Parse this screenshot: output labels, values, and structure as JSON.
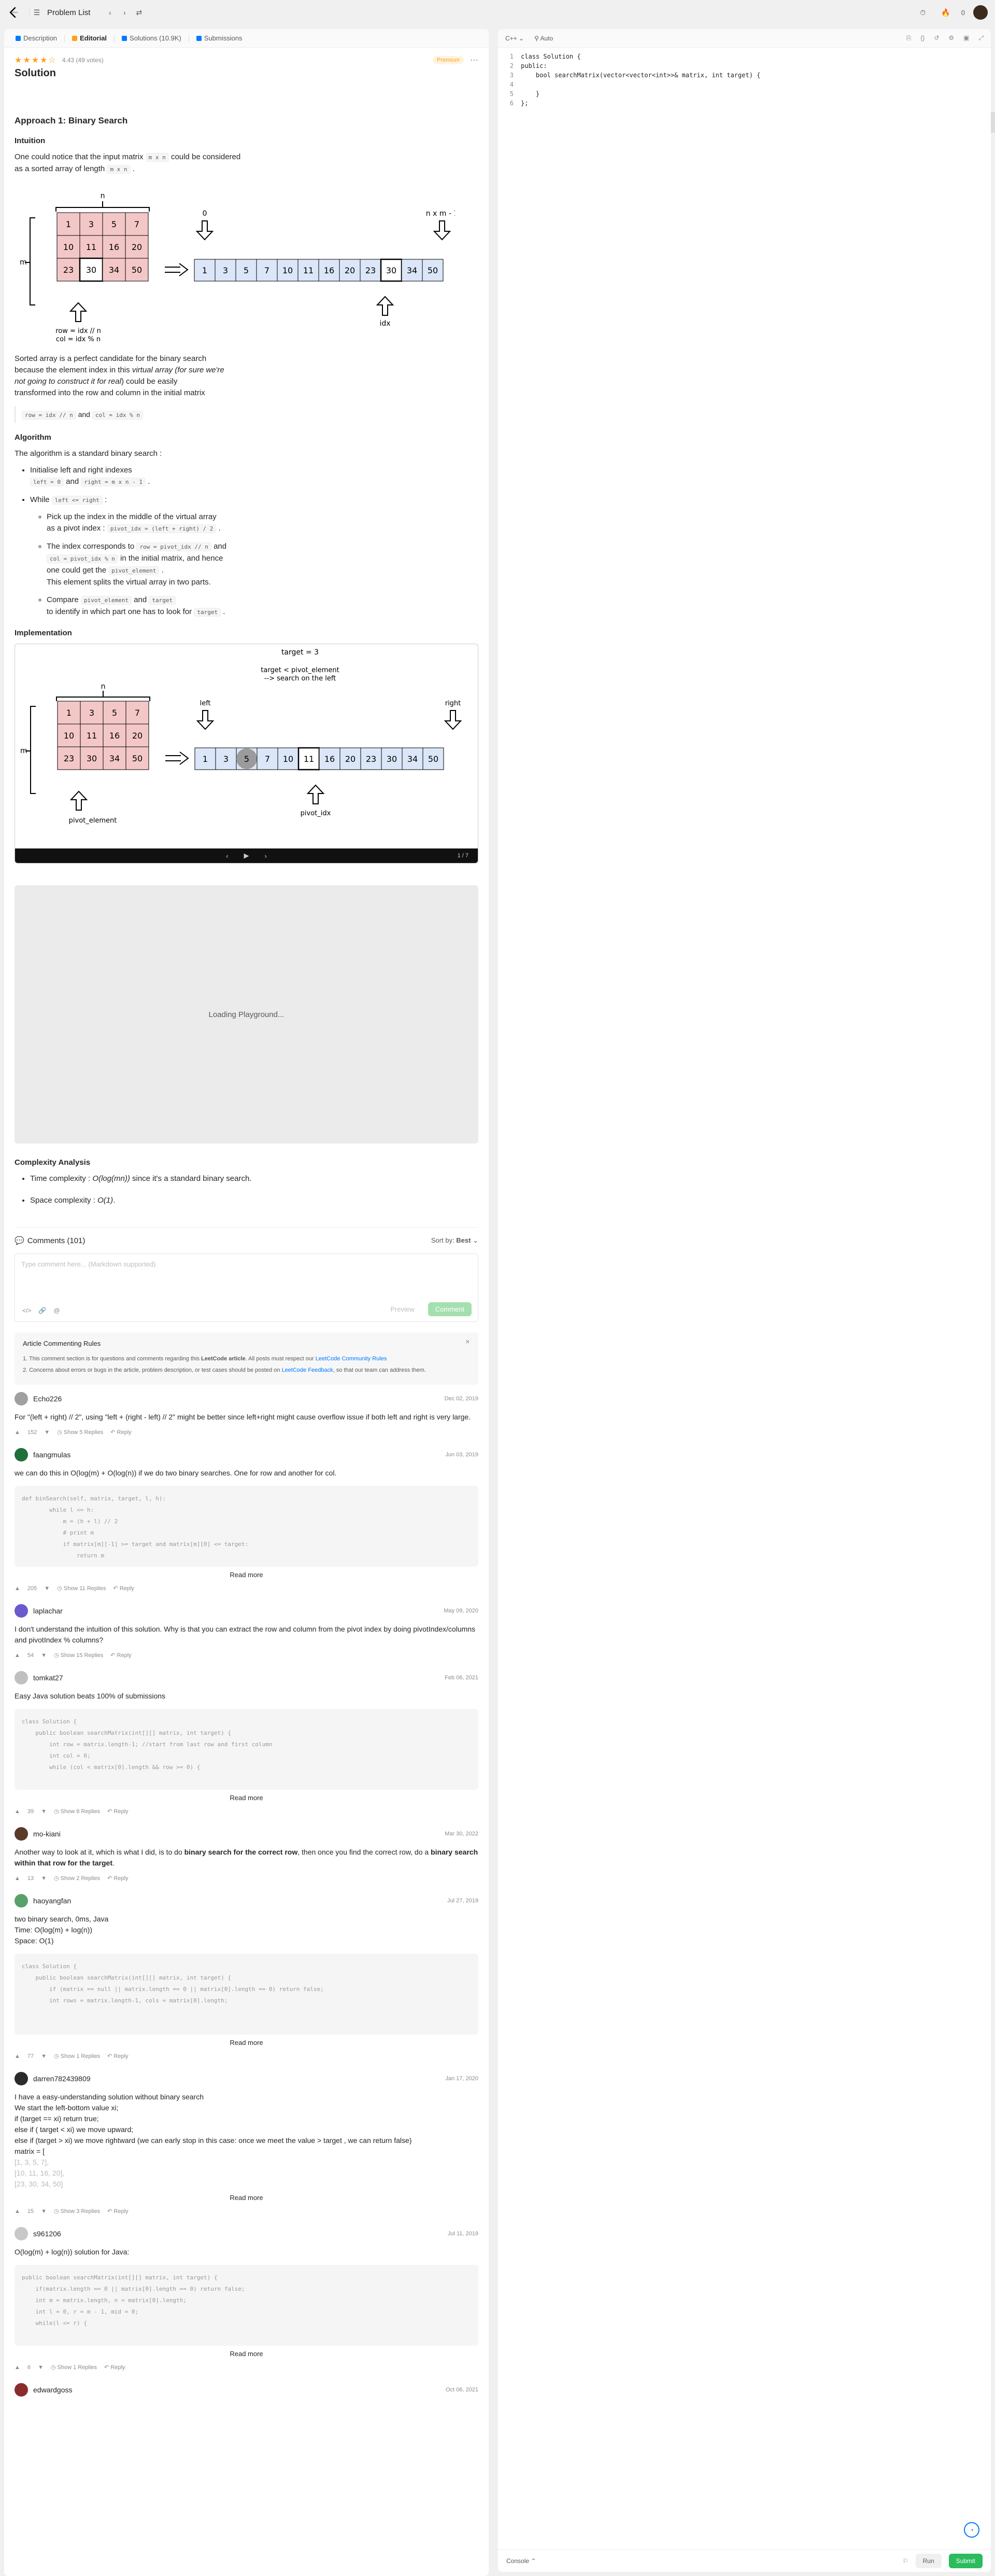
{
  "topbar": {
    "title": "Problem List",
    "premium_count": "0"
  },
  "tabs": [
    {
      "label": "Description"
    },
    {
      "label": "Editorial"
    },
    {
      "label": "Solutions (10.9K)"
    },
    {
      "label": "Submissions"
    }
  ],
  "article": {
    "rating_text": "4.43 (49 votes)",
    "premium_label": "Premium",
    "title": "Solution",
    "approach_title": "Approach 1: Binary Search",
    "intuition_title": "Intuition",
    "intuition_p1": "One could notice that the input matrix",
    "intuition_code1": "m x n",
    "intuition_p1b": "could be considered",
    "intuition_p2": "as a sorted array of length",
    "intuition_code2": "m x n",
    "sorted_p1": "Sorted array is a perfect candidate for the binary search",
    "sorted_p2a": "because the element index in this",
    "sorted_p2b": "virtual array",
    "sorted_p2c": "(for sure we're",
    "sorted_p3a": "not going to construct it for real",
    "sorted_p3b": ") could be easily",
    "sorted_p4": "transformed into the row and column in the initial matrix",
    "formula_a": "row = idx // n",
    "formula_and": "and",
    "formula_b": "col = idx % n",
    "algorithm_title": "Algorithm",
    "algo_intro": "The algorithm is a standard binary search :",
    "algo_1": "Initialise left and right indexes",
    "algo_1_code_a": "left = 0",
    "algo_1_and": "and",
    "algo_1_code_b": "right = m x n - 1",
    "algo_2_a": "While",
    "algo_2_code": "left <= right",
    "sub_1a": "Pick up the index in the middle of the virtual array",
    "sub_1b": "as a pivot index :",
    "sub_1_code": "pivot_idx = (left + right) / 2",
    "sub_2a": "The index corresponds to",
    "sub_2_code_a": "row = pivot_idx // n",
    "sub_2_and": "and",
    "sub_2_code_b": "col = pivot_idx % n",
    "sub_2b": "in the initial matrix, and hence",
    "sub_2c": "one could get the",
    "sub_2_code_c": "pivot_element",
    "sub_2d": "This element splits the virtual array in two parts.",
    "sub_3a": "Compare",
    "sub_3_code_a": "pivot_element",
    "sub_3_and": "and",
    "sub_3_code_b": "target",
    "sub_3b": "to identify in which part one has to look for",
    "sub_3_code_c": "target",
    "implementation_title": "Implementation",
    "slide_page": "1 / 7",
    "playground_text": "Loading Playground...",
    "complexity_title": "Complexity Analysis",
    "time_label": "Time complexity :",
    "time_val": "O(log(mn))",
    "time_rest": "since it's a standard binary search.",
    "space_label": "Space complexity :",
    "space_val": "O(1)"
  },
  "diagram1": {
    "n_label": "n",
    "m_label": "m",
    "matrix": [
      [
        "1",
        "3",
        "5",
        "7"
      ],
      [
        "10",
        "11",
        "16",
        "20"
      ],
      [
        "23",
        "30",
        "34",
        "50"
      ]
    ],
    "array": [
      "1",
      "3",
      "5",
      "7",
      "10",
      "11",
      "16",
      "20",
      "23",
      "30",
      "34",
      "50"
    ],
    "label_zero": "0",
    "label_end": "n x m - 1",
    "label_idx": "idx",
    "row_formula": "row = idx // n",
    "col_formula": "col = idx % n"
  },
  "diagram2": {
    "target": "target = 3",
    "cond1": "target < pivot_element",
    "cond2": "--> search on the left",
    "left": "left",
    "right": "right",
    "pivot_idx": "pivot_idx",
    "pivot_element": "pivot_element"
  },
  "comments": {
    "title": "Comments (101)",
    "sort_label": "Sort by:",
    "sort_value": "Best",
    "placeholder": "Type comment here... (Markdown supported)",
    "preview": "Preview",
    "comment_btn": "Comment",
    "rules_title": "Article Commenting Rules",
    "rule1_a": "1. This comment section is for questions and comments regarding this",
    "rule1_b": "LeetCode article",
    "rule1_c": ". All posts must respect our",
    "rule1_link": "LeetCode Community Rules",
    "rule2_a": "2. Concerns about errors or bugs in the article, problem description, or test cases should be posted on",
    "rule2_link": "LeetCode Feedback",
    "rule2_b": ", so that our team can address them.",
    "items": [
      {
        "name": "Echo226",
        "date": "Dec 02, 2019",
        "body": "For \"(left + right) // 2\", using \"left + (right - left) // 2\" might be better since left+right might cause overflow issue if both left and right is very large.",
        "votes": "152",
        "replies": "Show 5 Replies",
        "reply": "Reply"
      },
      {
        "name": "faangmulas",
        "date": "Jun 03, 2019",
        "body": "we can do this in O(log(m) + O(log(n)) if we do two binary searches. One for row and another for col.",
        "votes": "205",
        "replies": "Show 11 Replies",
        "reply": "Reply",
        "code": [
          "def binSearch(self, matrix, target, l, h):",
          "        while l <= h:",
          "            m = (h + l) // 2",
          "            # print m",
          "            if matrix[m][-1] >= target and matrix[m][0] <= target:",
          "                return m"
        ]
      },
      {
        "name": "laplachar",
        "date": "May 09, 2020",
        "body": "I don't understand the intuition of this solution. Why is that you can extract the row and column from the pivot index by doing pivotIndex/columns and pivotIndex % columns?",
        "votes": "54",
        "replies": "Show 15 Replies",
        "reply": "Reply"
      },
      {
        "name": "tomkat27",
        "date": "Feb 06, 2021",
        "body": "Easy Java solution beats 100% of submissions",
        "votes": "39",
        "replies": "Show 8 Replies",
        "reply": "Reply",
        "code": [
          "class Solution {",
          "    public boolean searchMatrix(int[][] matrix, int target) {",
          "        int row = matrix.length-1; //start from last row and first column",
          "        int col = 0;",
          "",
          "        while (col < matrix[0].length && row >= 0) {"
        ]
      },
      {
        "name": "mo-kiani",
        "date": "Mar 30, 2022",
        "body_a": "Another way to look at it, which is what I did, is to do ",
        "body_b": "binary search for the correct row",
        "body_c": ", then once you find the correct row, do a ",
        "body_d": "binary search within that row for the target",
        "votes": "13",
        "replies": "Show 2 Replies",
        "reply": "Reply"
      },
      {
        "name": "haoyangfan",
        "date": "Jul 27, 2019",
        "lines": [
          "two binary search, 0ms, Java",
          "Time: O(log(m) + log(n))",
          "Space: O(1)"
        ],
        "votes": "77",
        "replies": "Show 1 Replies",
        "reply": "Reply",
        "code": [
          "class Solution {",
          "    public boolean searchMatrix(int[][] matrix, int target) {",
          "        if (matrix == null || matrix.length == 0 || matrix[0].length == 0) return false;",
          "        int rows = matrix.length-1, cols = matrix[0].length;"
        ]
      },
      {
        "name": "darren782439809",
        "date": "Jan 17, 2020",
        "lines": [
          "I have a easy-understanding solution without binary search",
          "We start the left-bottom value xi;",
          "if  (target == xi) return true;",
          "else if ( target < xi) we move upward;",
          "else if (target > xi) we move rightward (we can early stop in this case: once we meet the value > target , we can return false)",
          "matrix = ["
        ],
        "muted": [
          "[1, 3, 5, 7],",
          "[10, 11, 16, 20],",
          "[23, 30, 34, 50]"
        ],
        "votes": "15",
        "replies": "Show 3 Replies",
        "reply": "Reply"
      },
      {
        "name": "s961206",
        "date": "Jul 11, 2019",
        "body": "O(log(m) + log(n)) solution for Java:",
        "votes": "6",
        "replies": "Show 1 Replies",
        "reply": "Reply",
        "code": [
          "public boolean searchMatrix(int[][] matrix, int target) {",
          "    if(matrix.length == 0 || matrix[0].length == 0) return false;",
          "",
          "    int m = matrix.length, n = matrix[0].length;",
          "    int l = 0, r = m - 1, mid = 0;",
          "    while(l <= r) {"
        ]
      },
      {
        "name": "edwardgoss",
        "date": "Oct 06, 2021"
      }
    ],
    "read_more": "Read more"
  },
  "editor": {
    "language": "C++",
    "mode": "Auto",
    "lines": [
      "class Solution {",
      "public:",
      "    bool searchMatrix(vector<vector<int>>& matrix, int target) {",
      "",
      "    }",
      "};"
    ],
    "console": "Console",
    "run": "Run",
    "submit": "Submit"
  }
}
